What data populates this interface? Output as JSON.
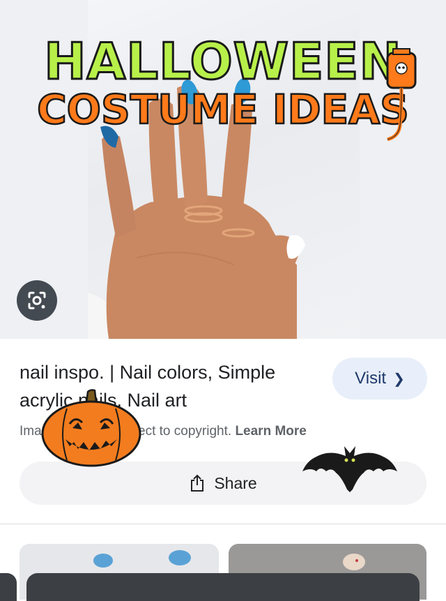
{
  "hero": {
    "headline_line1": "HALLOWEEN",
    "headline_line2": "COSTUME IDEAS"
  },
  "result": {
    "title": "nail inspo. | Nail colors, Simple acrylic nails, Nail art",
    "visit_label": "Visit",
    "notice_text": "Images may be subject to copyright.",
    "learn_more_label": "Learn More",
    "share_label": "Share"
  },
  "icons": {
    "lens": "lens-icon",
    "visit_chevron": "chevron-right-icon",
    "share": "share-icon",
    "iv_bag": "iv-bag-skull-icon",
    "pumpkin": "jack-o-lantern-icon",
    "bat": "bat-icon"
  },
  "colors": {
    "headline_green": "#b8f04a",
    "headline_orange": "#ff7a1a",
    "visit_bg": "#e8effa",
    "visit_text": "#1f3a6b",
    "share_bg": "#f3f3f5",
    "nail_blue": "#2e9ad6",
    "pumpkin_orange": "#f37c1e"
  }
}
